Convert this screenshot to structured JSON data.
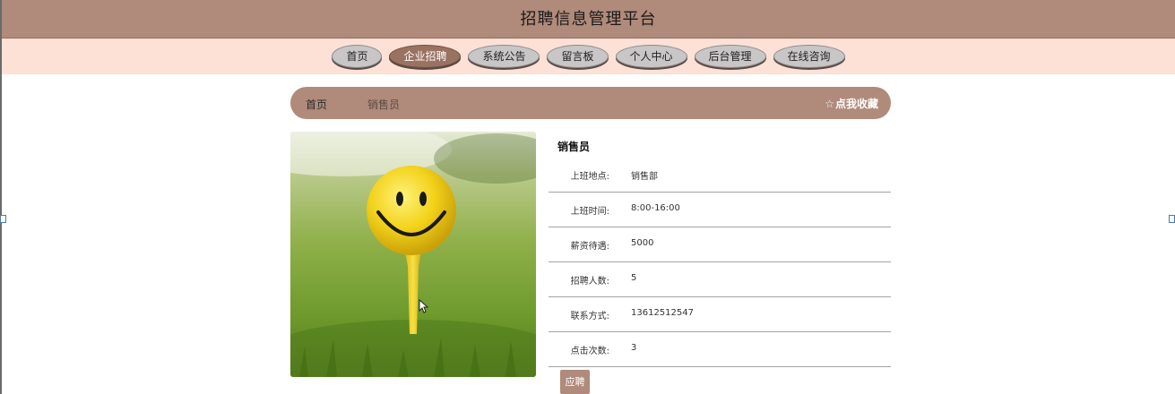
{
  "header": {
    "title": "招聘信息管理平台"
  },
  "nav": {
    "items": [
      {
        "label": "首页"
      },
      {
        "label": "企业招聘"
      },
      {
        "label": "系统公告"
      },
      {
        "label": "留言板"
      },
      {
        "label": "个人中心"
      },
      {
        "label": "后台管理"
      },
      {
        "label": "在线咨询"
      }
    ],
    "active_label": "企业招聘"
  },
  "breadcrumb": {
    "home": "首页",
    "current": "销售员",
    "favorite_label": "点我收藏",
    "favorite_icon": "star-outline-icon"
  },
  "job": {
    "title": "销售员",
    "image_description": "golf-ball-smiley-on-tee",
    "fields": [
      {
        "label": "上班地点:",
        "value": "销售部"
      },
      {
        "label": "上班时间:",
        "value": "8:00-16:00"
      },
      {
        "label": "薪资待遇:",
        "value": "5000"
      },
      {
        "label": "招聘人数:",
        "value": "5"
      },
      {
        "label": "联系方式:",
        "value": "13612512547"
      },
      {
        "label": "点击次数:",
        "value": "3"
      }
    ],
    "apply_label": "应聘"
  },
  "colors": {
    "header_bg": "#b08a7a",
    "nav_bg": "#fde0d6",
    "nav_item_bg": "#c8c6c6",
    "nav_active_bg": "#9a7262",
    "accent": "#b08a7a"
  }
}
